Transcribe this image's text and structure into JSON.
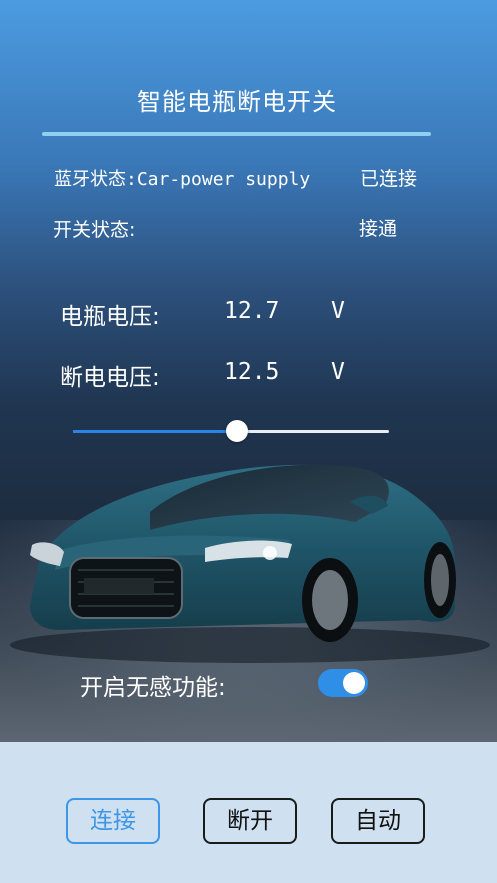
{
  "title": "智能电瓶断电开关",
  "bluetooth": {
    "label": "蓝牙状态:Car-power supply",
    "status": "已连接"
  },
  "switch": {
    "label": "开关状态:",
    "status": "接通"
  },
  "battery_voltage": {
    "label": "电瓶电压:",
    "value": "12.7",
    "unit": "V"
  },
  "cutoff_voltage": {
    "label": "断电电压:",
    "value": "12.5",
    "unit": "V"
  },
  "slider": {
    "level_fraction": 0.52
  },
  "auto_feature": {
    "label": "开启无感功能:",
    "enabled": true
  },
  "buttons": {
    "connect": "连接",
    "disconnect": "断开",
    "auto": "自动"
  },
  "colors": {
    "accent": "#2f8ee6",
    "active_button": "#3d96e6",
    "footer_bg": "#cfe0f1",
    "title_line": "#8fd0f2"
  }
}
